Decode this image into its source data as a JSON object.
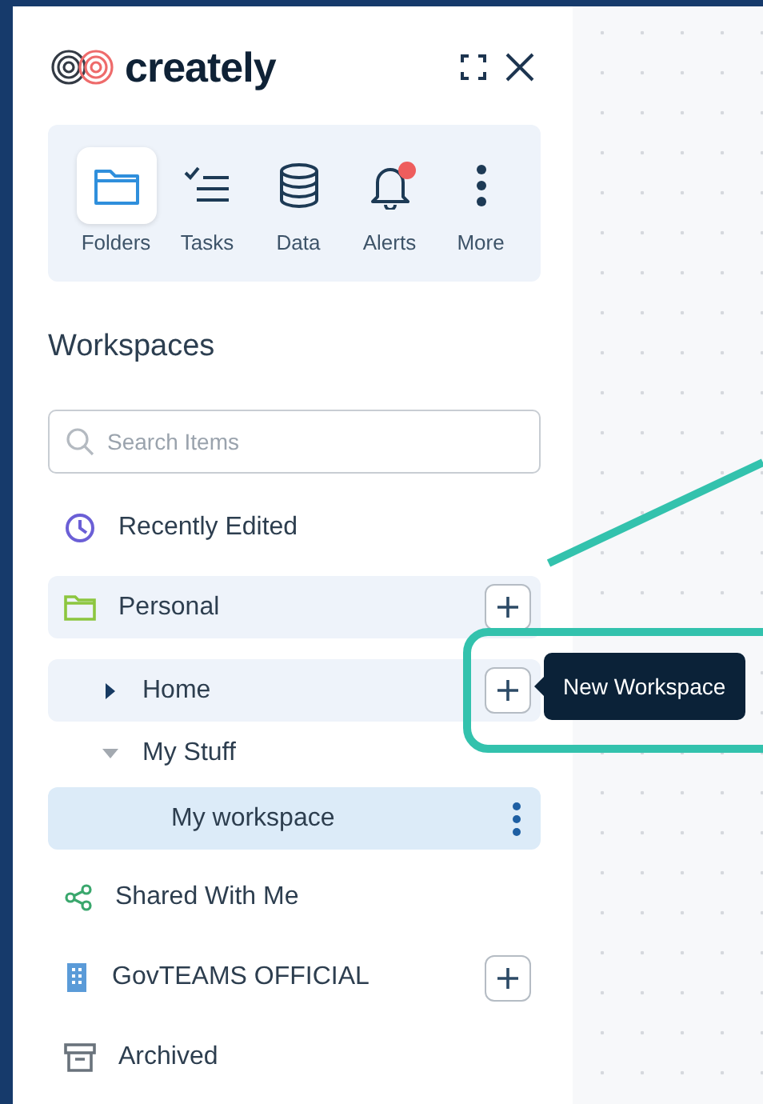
{
  "logo": {
    "text": "creately"
  },
  "header_buttons": [
    {
      "kind": "expand"
    },
    {
      "kind": "close"
    }
  ],
  "toolbar": [
    {
      "kind": "folders",
      "label": "Folders",
      "selected": true,
      "badge": false
    },
    {
      "kind": "tasks",
      "label": "Tasks",
      "selected": false,
      "badge": false
    },
    {
      "kind": "data",
      "label": "Data",
      "selected": false,
      "badge": false
    },
    {
      "kind": "alerts",
      "label": "Alerts",
      "selected": false,
      "badge": true
    },
    {
      "kind": "more",
      "label": "More",
      "selected": false,
      "badge": false
    }
  ],
  "heading": "Workspaces",
  "search": {
    "placeholder": "Search Items"
  },
  "tree": [
    {
      "kind": "recent",
      "label": "Recently Edited",
      "selected": false,
      "highlighted": false,
      "add_button": false,
      "menu": false
    },
    {
      "kind": "folder",
      "label": "Personal",
      "selected": false,
      "highlighted": true,
      "add_button": true,
      "menu": false,
      "children": [
        {
          "kind": "group",
          "label": "Home",
          "selected": false,
          "highlighted": true,
          "expanded": false,
          "add_button": true,
          "menu": false,
          "tooltip": "New Workspace"
        },
        {
          "kind": "group",
          "label": "My Stuff",
          "selected": false,
          "highlighted": false,
          "expanded": true,
          "add_button": false,
          "menu": false,
          "children": [
            {
              "kind": "workspace",
              "label": "My workspace",
              "selected": true,
              "highlighted": false,
              "add_button": false,
              "menu": true
            }
          ]
        }
      ]
    },
    {
      "kind": "shared",
      "label": "Shared With Me",
      "selected": false,
      "highlighted": false,
      "add_button": false,
      "menu": false
    },
    {
      "kind": "team",
      "label": "GovTEAMS OFFICIAL",
      "selected": false,
      "highlighted": false,
      "add_button": true,
      "menu": false
    },
    {
      "kind": "archived",
      "label": "Archived",
      "selected": false,
      "highlighted": false,
      "add_button": false,
      "menu": false
    }
  ]
}
